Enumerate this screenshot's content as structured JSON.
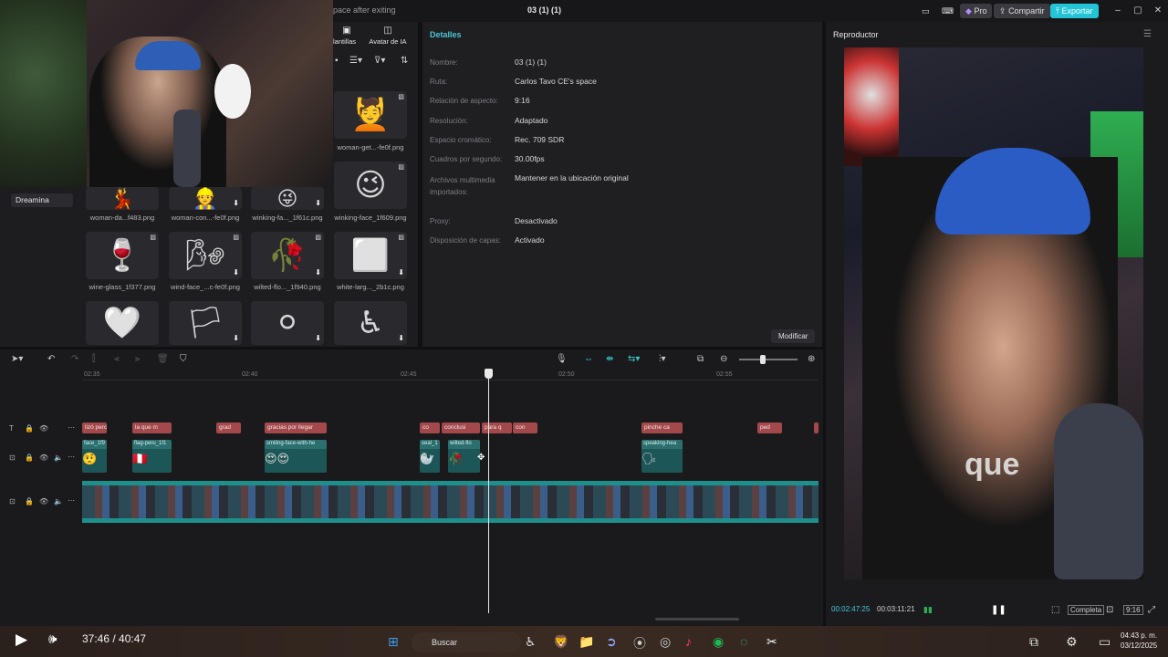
{
  "titlebar": {
    "hint": "pace after exiting",
    "title": "03 (1) (1)",
    "pro_label": "Pro",
    "share_label": "Compartir",
    "export_label": "Exportar",
    "accent": "#23c4d6"
  },
  "media_tabs": [
    {
      "label": "Plantillas",
      "icon": "template-icon"
    },
    {
      "label": "Avatar de IA",
      "icon": "avatar-icon"
    }
  ],
  "sidebar": {
    "item": "Dreamina"
  },
  "media_items": [
    {
      "label": "woman-get...-fe0f.png",
      "emoji": "💆"
    },
    {
      "label": "woman-da...f483.png",
      "emoji": "💃"
    },
    {
      "label": "woman-con...-fe0f.png",
      "emoji": "👷"
    },
    {
      "label": "winking-fa..._1f61c.png",
      "emoji": "😜"
    },
    {
      "label": "winking-face_1f609.png",
      "emoji": "😉"
    },
    {
      "label": "wine-glass_1f377.png",
      "emoji": "🍷"
    },
    {
      "label": "wind-face_...c-fe0f.png",
      "emoji": "🌬"
    },
    {
      "label": "wilted-flo..._1f940.png",
      "emoji": "🥀"
    },
    {
      "label": "white-larg..._2b1c.png",
      "emoji": "⬜"
    },
    {
      "label": "",
      "emoji": "🤍"
    },
    {
      "label": "",
      "emoji": "🏳"
    },
    {
      "label": "",
      "emoji": "⚪"
    },
    {
      "label": "",
      "emoji": "♿"
    }
  ],
  "details": {
    "header": "Detalles",
    "rows": [
      {
        "key": "Nombre:",
        "value": "03 (1) (1)"
      },
      {
        "key": "Ruta:",
        "value": "Carlos Tavo CE's space"
      },
      {
        "key": "Relación de aspecto:",
        "value": "9:16"
      },
      {
        "key": "Resolución:",
        "value": "Adaptado"
      },
      {
        "key": "Espacio cromático:",
        "value": "Rec. 709 SDR"
      },
      {
        "key": "Cuadros por segundo:",
        "value": "30.00fps"
      },
      {
        "key": "Archivos multimedia importados:",
        "value": "Mantener en la ubicación original"
      },
      {
        "key": "Proxy:",
        "value": "Desactivado"
      },
      {
        "key": "Disposición de capas:",
        "value": "Activado"
      }
    ],
    "modify_label": "Modificar"
  },
  "player": {
    "header": "Reproductor",
    "overlay_word": "que",
    "current_time": "00:02:47:25",
    "total_time": "00:03:11:21",
    "fit_label": "Completa",
    "ratio_label": "9:16"
  },
  "timeline": {
    "ticks": [
      "02:35",
      "02:40",
      "02:45",
      "02:50",
      "02:55"
    ],
    "text_clips": [
      "lizó perc",
      "la que m",
      "grad",
      "gracias por llegar",
      "co",
      "conclusi",
      "para q",
      "con",
      "pinche ca",
      "ped",
      ""
    ],
    "sticker_clips": [
      {
        "label": "face_1f9",
        "emoji": "🤨"
      },
      {
        "label": "flag-peru_1f1",
        "emoji": "🇵🇪"
      },
      {
        "label": "smiling-face-with-he",
        "emoji": "😍😍"
      },
      {
        "label": "seal_1",
        "emoji": "🦭"
      },
      {
        "label": "wilted-flo",
        "emoji": "🥀"
      },
      {
        "label": "speaking-hea",
        "emoji": "🗣"
      }
    ]
  },
  "taskbar": {
    "video_time": "37:46 / 40:47",
    "search_placeholder": "Buscar",
    "clock_time": "04:43 p. m.",
    "clock_date": "03/12/2025"
  }
}
